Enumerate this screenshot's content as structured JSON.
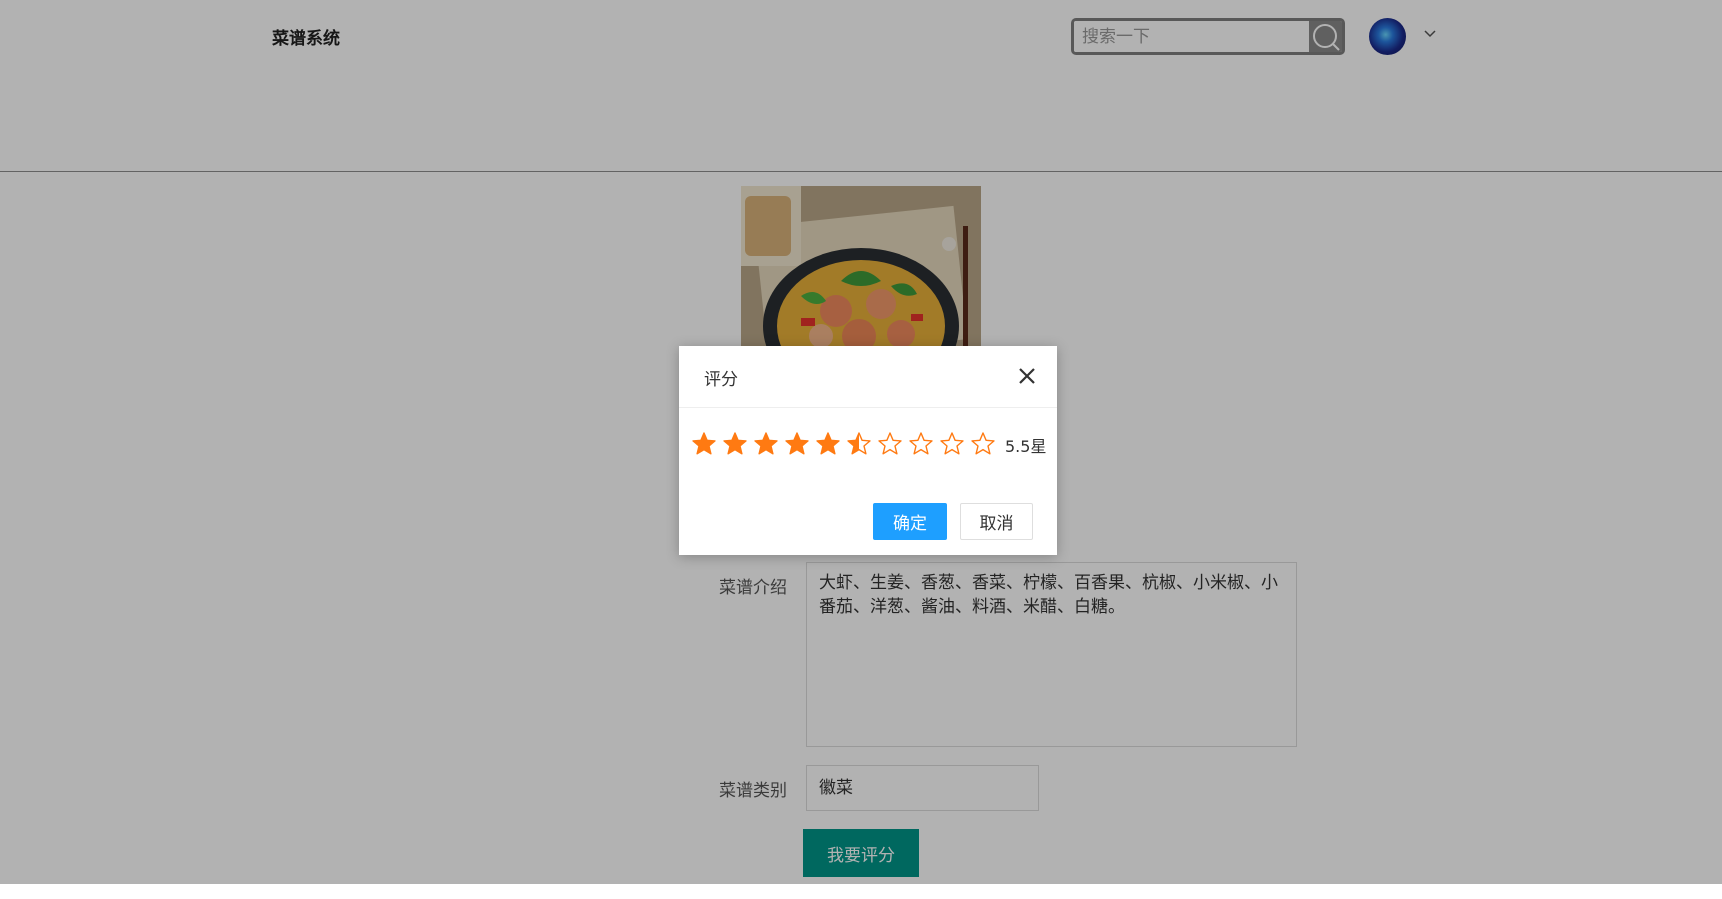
{
  "header": {
    "brand": "菜谱系统",
    "search_placeholder": "搜索一下"
  },
  "form": {
    "intro_label": "菜谱介绍",
    "intro_value": "大虾、生姜、香葱、香菜、柠檬、百香果、杭椒、小米椒、小番茄、洋葱、酱油、料酒、米醋、白糖。",
    "category_label": "菜谱类别",
    "category_value": "徽菜",
    "rate_button": "我要评分"
  },
  "modal": {
    "title": "评分",
    "rating": 5.5,
    "max_stars": 10,
    "rating_text": "5.5星",
    "ok_label": "确定",
    "cancel_label": "取消",
    "star_color": "#ff7a12"
  },
  "icons": {
    "search": "search-icon",
    "caret": "chevron-down-icon",
    "close": "close-icon",
    "star": "star-icon"
  }
}
